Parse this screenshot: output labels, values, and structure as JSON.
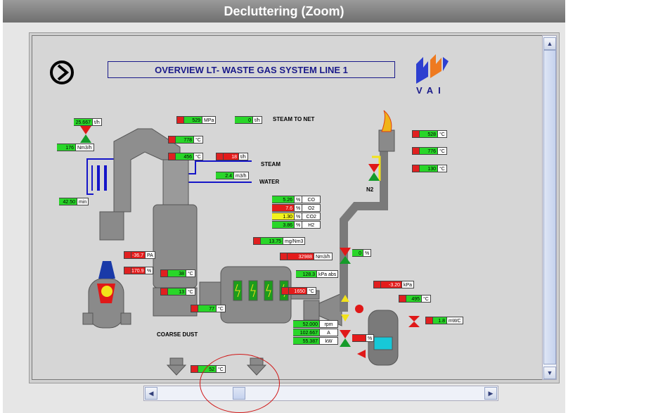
{
  "window": {
    "title": "Decluttering (Zoom)"
  },
  "diagram": {
    "title": "OVERVIEW LT- WASTE GAS  SYSTEM LINE 1",
    "vai_logo_text": "VAI",
    "labels": {
      "steam_to_net": "STEAM TO NET",
      "steam": "STEAM",
      "water": "WATER",
      "n2": "N2",
      "coarse_dust": "COARSE DUST"
    },
    "measurements": [
      {
        "value": "25.667",
        "unit": "t/h",
        "color": "green"
      },
      {
        "value": "176",
        "unit": "Nm3/h",
        "color": "green"
      },
      {
        "value": "42.50",
        "unit": "min",
        "color": "green"
      },
      {
        "value": "529",
        "unit": "MPa",
        "color": "green"
      },
      {
        "value": "0",
        "unit": "t/h",
        "color": "green"
      },
      {
        "value": "778",
        "unit": "°C",
        "color": "green"
      },
      {
        "value": "456",
        "unit": "°C",
        "color": "green"
      },
      {
        "value": "18",
        "unit": "t/h",
        "color": "red"
      },
      {
        "value": "2.4",
        "unit": "m3/h",
        "color": "green"
      },
      {
        "value": "-36.7",
        "unit": "PA",
        "color": "red"
      },
      {
        "value": "170.9",
        "unit": "%",
        "color": "red"
      },
      {
        "value": "38",
        "unit": "°C",
        "color": "green"
      },
      {
        "value": "13",
        "unit": "°C",
        "color": "green"
      },
      {
        "value": "77",
        "unit": "°C",
        "color": "green"
      },
      {
        "value": "528",
        "unit": "°C",
        "color": "green"
      },
      {
        "value": "776",
        "unit": "°C",
        "color": "green"
      },
      {
        "value": "130",
        "unit": "°C",
        "color": "green"
      },
      {
        "value": "13.75",
        "unit": "mg/Nm3",
        "color": "green"
      },
      {
        "value": "32988",
        "unit": "Nm3/h",
        "color": "red"
      },
      {
        "value": "0",
        "unit": "%",
        "color": "green"
      },
      {
        "value": "128.3",
        "unit": "kPa abs",
        "color": "green"
      },
      {
        "value": "1650",
        "unit": "°C",
        "color": "red"
      },
      {
        "value": "-3.20",
        "unit": "kPa",
        "color": "red"
      },
      {
        "value": "495",
        "unit": "°C",
        "color": "green"
      },
      {
        "value": "1.8",
        "unit": "mWC",
        "color": "green"
      },
      {
        "value": "52.000",
        "unit": "rpm",
        "color": "green"
      },
      {
        "value": "102.667",
        "unit": "A",
        "color": "green"
      },
      {
        "value": "55.387",
        "unit": "kW",
        "color": "green"
      },
      {
        "value": "",
        "unit": "%",
        "color": "red"
      },
      {
        "value": "52",
        "unit": "°C",
        "color": "green"
      }
    ],
    "gas_analysis": [
      {
        "value": "5.26",
        "unit": "%",
        "gas": "CO",
        "color": "green"
      },
      {
        "value": "7.6",
        "unit": "%",
        "gas": "O2",
        "color": "red"
      },
      {
        "value": "1.30",
        "unit": "%",
        "gas": "CO2",
        "color": "yellow"
      },
      {
        "value": "3.86",
        "unit": "%",
        "gas": "H2",
        "color": "green"
      }
    ]
  },
  "colors": {
    "pipe": "#7a7a7a",
    "steam_line": "#1515c8",
    "nitrogen_line": "#f2e21a",
    "valve_red": "#e01818",
    "valve_green": "#159b2a",
    "canvas_bg": "#d6d6d6",
    "title_blue": "#1a1a8a"
  }
}
